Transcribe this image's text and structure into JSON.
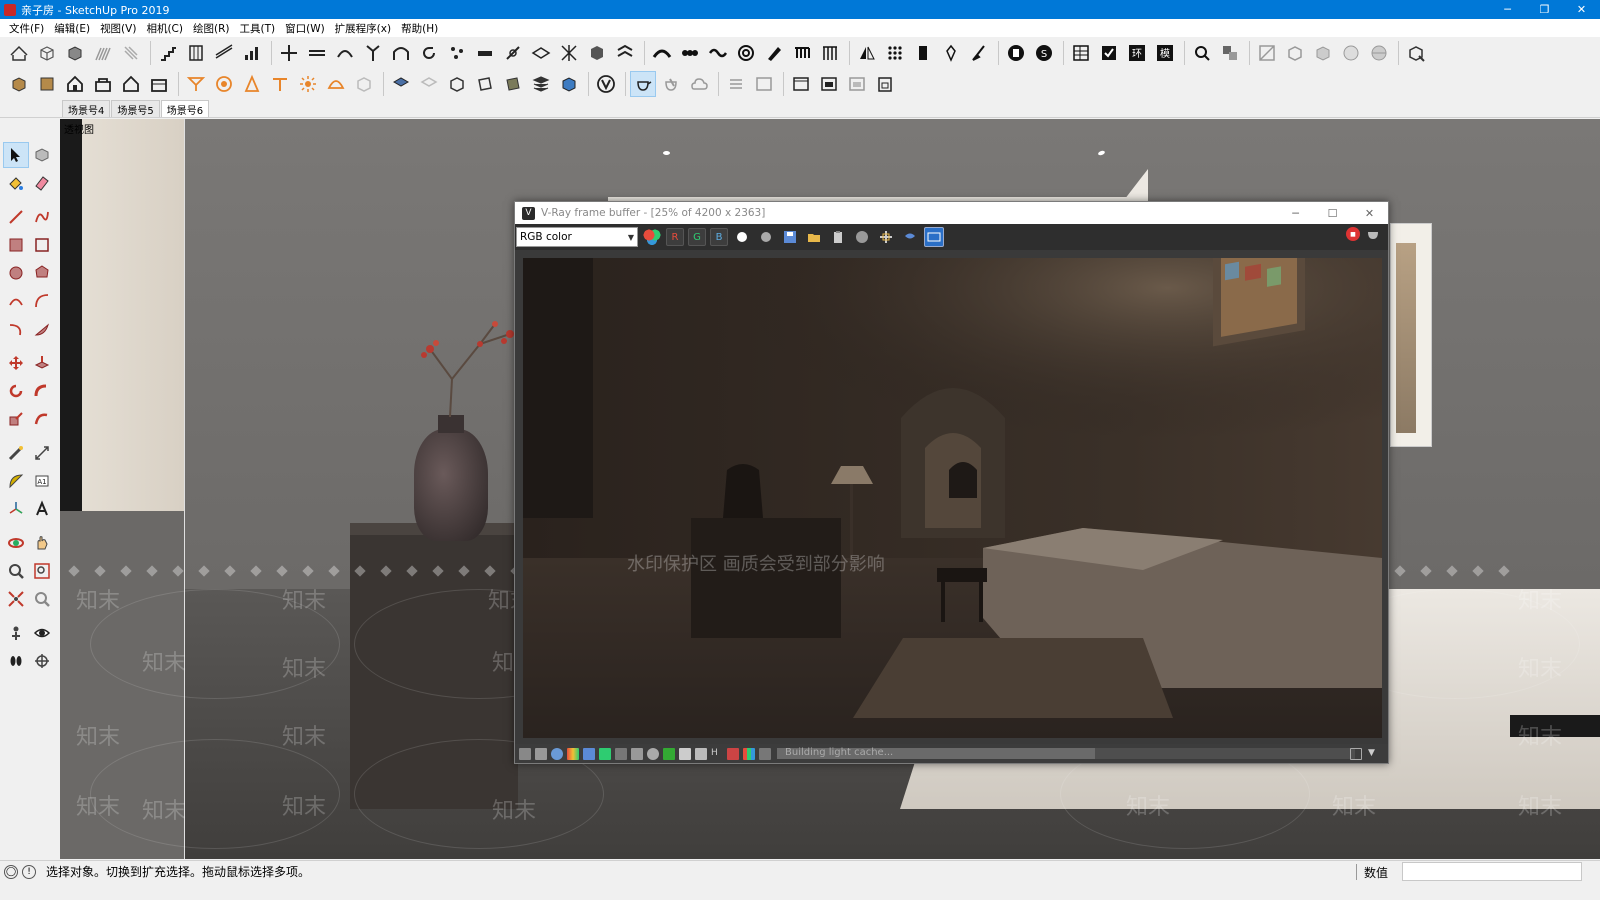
{
  "window": {
    "title": "亲子房 - SketchUp Pro 2019",
    "controls": [
      "─",
      "❐",
      "✕"
    ]
  },
  "menu": [
    "文件(F)",
    "编辑(E)",
    "视图(V)",
    "相机(C)",
    "绘图(R)",
    "工具(T)",
    "窗口(W)",
    "扩展程序(x)",
    "帮助(H)"
  ],
  "scene_tabs": [
    {
      "label": "场景号4",
      "active": false
    },
    {
      "label": "场景号5",
      "active": false
    },
    {
      "label": "场景号6",
      "active": true
    }
  ],
  "viewport": {
    "label": "透视图",
    "watermark_text": "知末",
    "watermark_notice": "水印保护区   画质会受到部分影响"
  },
  "vfb": {
    "title": "V-Ray frame buffer - [25% of 4200 x 2363]",
    "controls": [
      "─",
      "☐",
      "✕"
    ],
    "channel": "RGB color",
    "buttons": {
      "r": "R",
      "g": "G",
      "b": "B"
    },
    "status": "Building light cache...",
    "progress": 0.55
  },
  "statusbar": {
    "message": "选择对象。切换到扩充选择。拖动鼠标选择多项。",
    "measure_label": "数值"
  }
}
